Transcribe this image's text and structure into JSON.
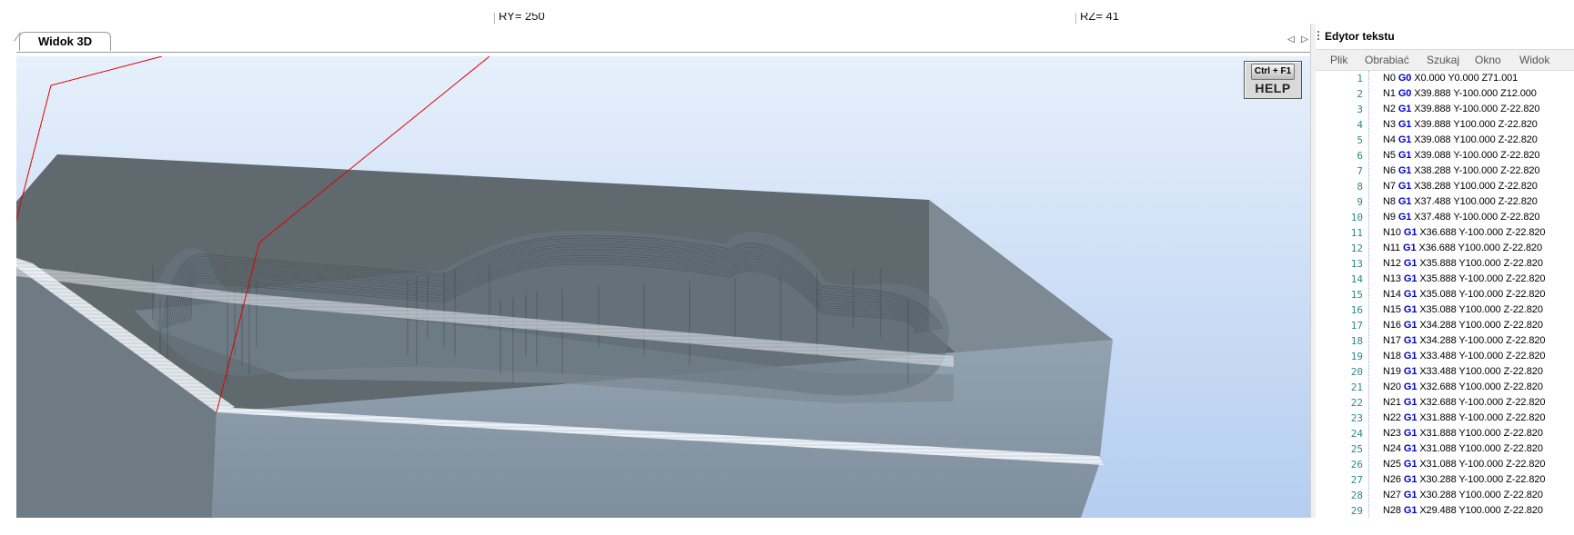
{
  "coords": {
    "ry": "RY= 250",
    "rz": "RZ= 41"
  },
  "tabs": [
    {
      "label": "Widok 3D"
    }
  ],
  "tab_nav": {
    "prev": "◁",
    "next": "▷"
  },
  "help": {
    "key": "Ctrl + F1",
    "label": "HELP"
  },
  "editor": {
    "title": "Edytor tekstu",
    "menu": [
      "Plik",
      "Obrabiać",
      "Szukaj",
      "Okno",
      "Widok"
    ],
    "lines": [
      {
        "n": "1",
        "block": "N0",
        "g": "G0",
        "rest": "X0.000 Y0.000 Z71.001"
      },
      {
        "n": "2",
        "block": "N1",
        "g": "G0",
        "rest": "X39.888 Y-100.000 Z12.000"
      },
      {
        "n": "3",
        "block": "N2",
        "g": "G1",
        "rest": "X39.888 Y-100.000 Z-22.820"
      },
      {
        "n": "4",
        "block": "N3",
        "g": "G1",
        "rest": "X39.888 Y100.000 Z-22.820"
      },
      {
        "n": "5",
        "block": "N4",
        "g": "G1",
        "rest": "X39.088 Y100.000 Z-22.820"
      },
      {
        "n": "6",
        "block": "N5",
        "g": "G1",
        "rest": "X39.088 Y-100.000 Z-22.820"
      },
      {
        "n": "7",
        "block": "N6",
        "g": "G1",
        "rest": "X38.288 Y-100.000 Z-22.820"
      },
      {
        "n": "8",
        "block": "N7",
        "g": "G1",
        "rest": "X38.288 Y100.000 Z-22.820"
      },
      {
        "n": "9",
        "block": "N8",
        "g": "G1",
        "rest": "X37.488 Y100.000 Z-22.820"
      },
      {
        "n": "10",
        "block": "N9",
        "g": "G1",
        "rest": "X37.488 Y-100.000 Z-22.820"
      },
      {
        "n": "11",
        "block": "N10",
        "g": "G1",
        "rest": "X36.688 Y-100.000 Z-22.820"
      },
      {
        "n": "12",
        "block": "N11",
        "g": "G1",
        "rest": "X36.688 Y100.000 Z-22.820"
      },
      {
        "n": "13",
        "block": "N12",
        "g": "G1",
        "rest": "X35.888 Y100.000 Z-22.820"
      },
      {
        "n": "14",
        "block": "N13",
        "g": "G1",
        "rest": "X35.888 Y-100.000 Z-22.820"
      },
      {
        "n": "15",
        "block": "N14",
        "g": "G1",
        "rest": "X35.088 Y-100.000 Z-22.820"
      },
      {
        "n": "16",
        "block": "N15",
        "g": "G1",
        "rest": "X35.088 Y100.000 Z-22.820"
      },
      {
        "n": "17",
        "block": "N16",
        "g": "G1",
        "rest": "X34.288 Y100.000 Z-22.820"
      },
      {
        "n": "18",
        "block": "N17",
        "g": "G1",
        "rest": "X34.288 Y-100.000 Z-22.820"
      },
      {
        "n": "19",
        "block": "N18",
        "g": "G1",
        "rest": "X33.488 Y-100.000 Z-22.820"
      },
      {
        "n": "20",
        "block": "N19",
        "g": "G1",
        "rest": "X33.488 Y100.000 Z-22.820"
      },
      {
        "n": "21",
        "block": "N20",
        "g": "G1",
        "rest": "X32.688 Y100.000 Z-22.820"
      },
      {
        "n": "22",
        "block": "N21",
        "g": "G1",
        "rest": "X32.688 Y-100.000 Z-22.820"
      },
      {
        "n": "23",
        "block": "N22",
        "g": "G1",
        "rest": "X31.888 Y-100.000 Z-22.820"
      },
      {
        "n": "24",
        "block": "N23",
        "g": "G1",
        "rest": "X31.888 Y100.000 Z-22.820"
      },
      {
        "n": "25",
        "block": "N24",
        "g": "G1",
        "rest": "X31.088 Y100.000 Z-22.820"
      },
      {
        "n": "26",
        "block": "N25",
        "g": "G1",
        "rest": "X31.088 Y-100.000 Z-22.820"
      },
      {
        "n": "27",
        "block": "N26",
        "g": "G1",
        "rest": "X30.288 Y-100.000 Z-22.820"
      },
      {
        "n": "28",
        "block": "N27",
        "g": "G1",
        "rest": "X30.288 Y100.000 Z-22.820"
      },
      {
        "n": "29",
        "block": "N28",
        "g": "G1",
        "rest": "X29.488 Y100.000 Z-22.820"
      }
    ]
  },
  "colors": {
    "toolpath_rapid": "#e00000",
    "block_top": "#5d676b",
    "block_front": "#8795a3",
    "block_side": "#7a8891",
    "gcode_keyword": "#0000cc",
    "line_number": "#2a8a8a"
  }
}
